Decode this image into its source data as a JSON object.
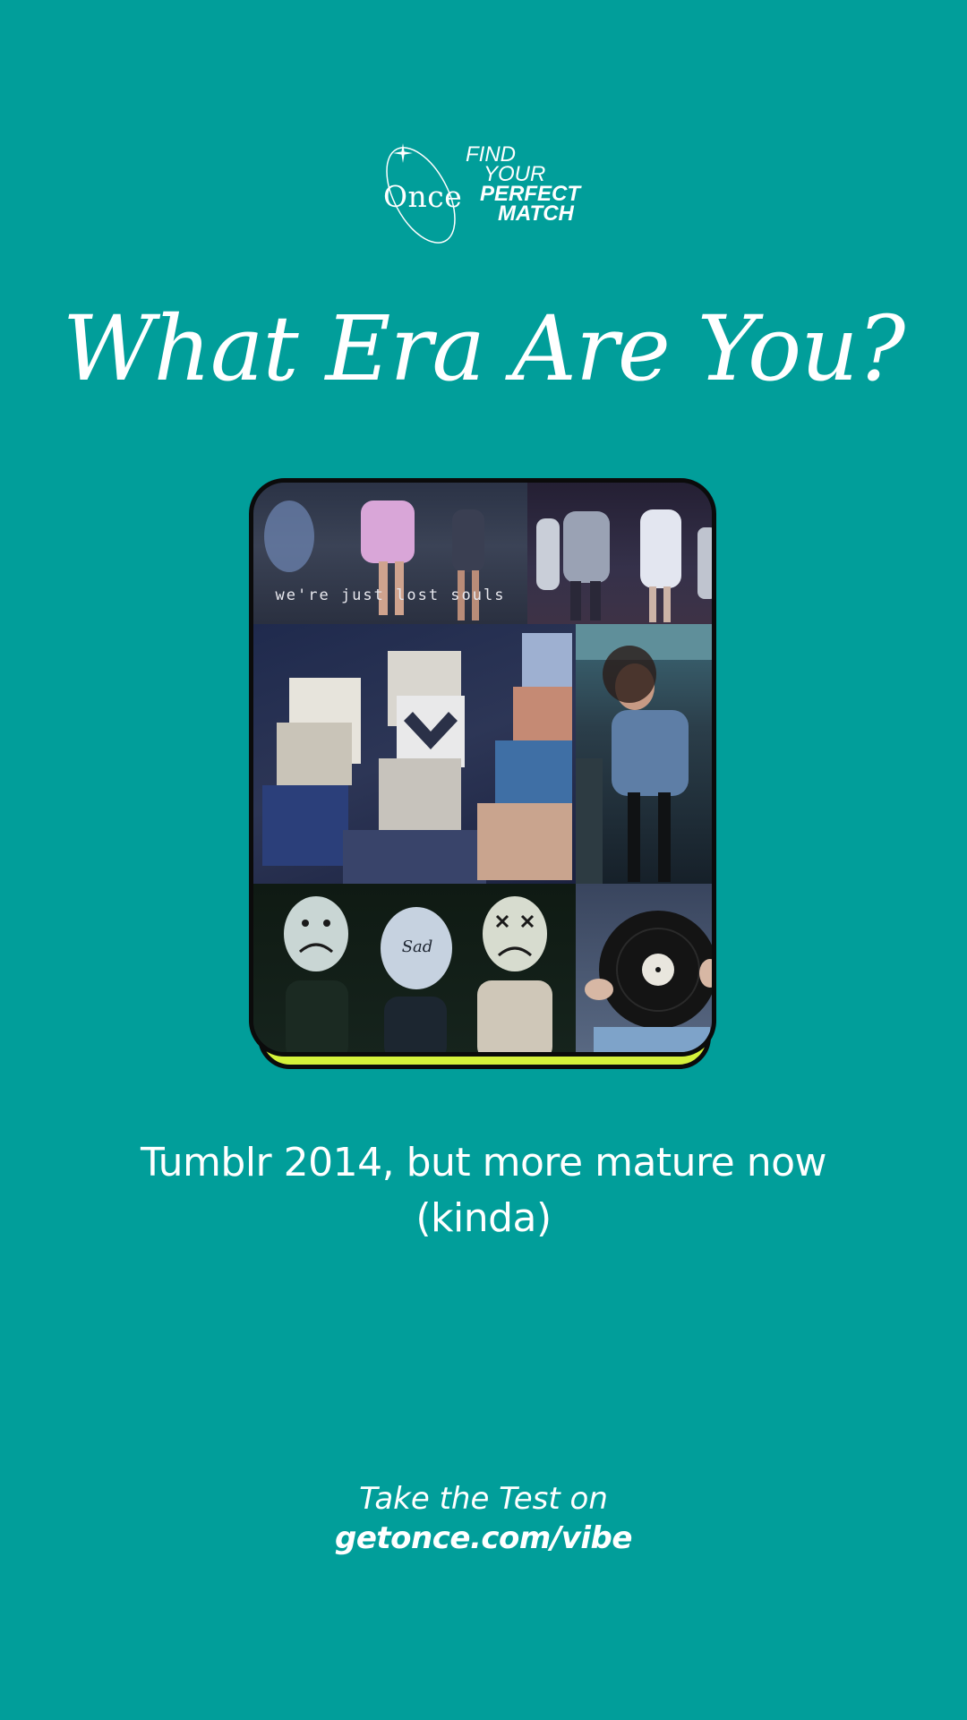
{
  "brand": {
    "logo_text": "Once",
    "tagline": [
      "FIND",
      "YOUR",
      "PERFECT",
      "MATCH"
    ]
  },
  "headline": "What Era Are You?",
  "collage": {
    "caption_top": "we're just lost souls",
    "balloon_text": "Sad"
  },
  "subtitle": {
    "line1": "Tumblr 2014, but more mature now",
    "line2": "(kinda)"
  },
  "cta": {
    "line": "Take the Test on",
    "url": "getonce.com/vibe"
  },
  "colors": {
    "background": "#019e9a",
    "accent": "#d5f23b",
    "outline": "#0b0b0b",
    "text": "#ffffff"
  },
  "icons": [
    "sparkle-icon",
    "orbit-ring-icon"
  ]
}
